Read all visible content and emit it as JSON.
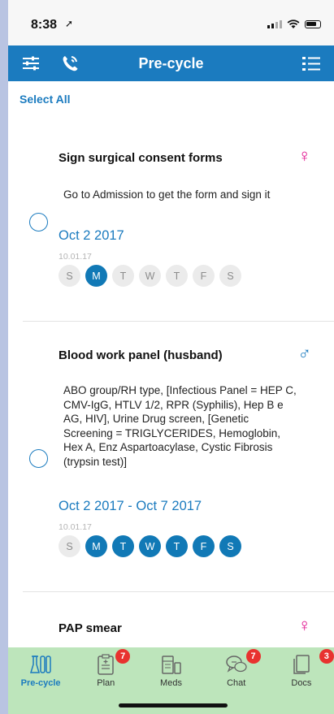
{
  "status": {
    "time": "8:38"
  },
  "nav": {
    "title": "Pre-cycle"
  },
  "select_all": "Select All",
  "tasks": [
    {
      "title": "Sign surgical consent forms",
      "gender": "♀",
      "gender_color": "#e0108e",
      "description": "Go to Admission to get the form and sign it",
      "date": "Oct 2 2017",
      "small_date": "10.01.17",
      "days": [
        "S",
        "M",
        "T",
        "W",
        "T",
        "F",
        "S"
      ]
    },
    {
      "title": "Blood work panel (husband)",
      "gender": "♂",
      "gender_color": "#1b7bbf",
      "description": "ABO group/RH type, [Infectious Panel = HEP C, CMV-IgG, HTLV 1/2, RPR (Syphilis), Hep B e AG, HIV], Urine Drug screen, [Genetic Screening = TRIGLYCERIDES, Hemoglobin, Hex A, Enz Aspartoacylase, Cystic Fibrosis (trypsin test)]",
      "date": "Oct 2 2017 - Oct 7 2017",
      "small_date": "10.01.17",
      "days": [
        "S",
        "M",
        "T",
        "W",
        "T",
        "F",
        "S"
      ]
    },
    {
      "title": "PAP smear",
      "gender": "♀",
      "gender_color": "#e0108e"
    }
  ],
  "tabs": [
    {
      "label": "Pre-cycle",
      "badge": ""
    },
    {
      "label": "Plan",
      "badge": "7"
    },
    {
      "label": "Meds",
      "badge": ""
    },
    {
      "label": "Chat",
      "badge": "7"
    },
    {
      "label": "Docs",
      "badge": "3"
    }
  ],
  "colors": {
    "primary": "#1b7bbf",
    "tab_bar": "#bde5bb",
    "badge": "#e8322f",
    "female": "#e0108e"
  }
}
